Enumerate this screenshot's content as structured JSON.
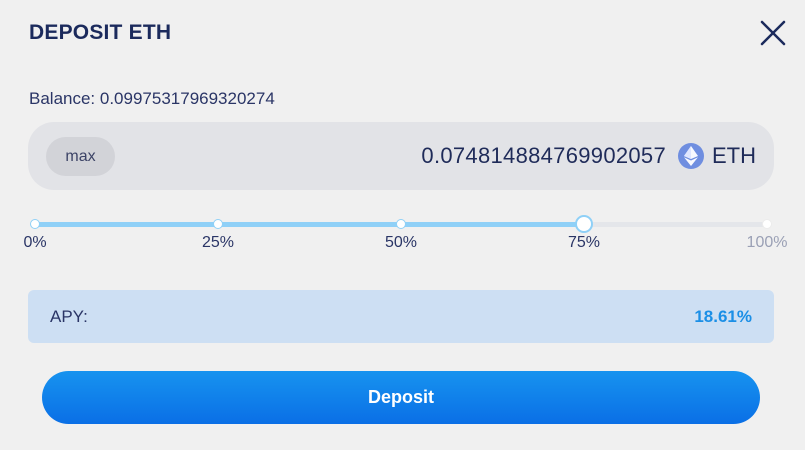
{
  "modal": {
    "title": "DEPOSIT ETH",
    "close_icon": "close-icon"
  },
  "balance": {
    "text": "Balance: 0.09975317969320274"
  },
  "amount": {
    "max_label": "max",
    "value": "0.074814884769902057",
    "token_symbol": "ETH",
    "token_icon": "ethereum-icon",
    "token_icon_color": "#6f8ee0"
  },
  "slider": {
    "value_percent": 75,
    "ticks": [
      {
        "percent": 0,
        "label": "0%"
      },
      {
        "percent": 25,
        "label": "25%"
      },
      {
        "percent": 50,
        "label": "50%"
      },
      {
        "percent": 75,
        "label": "75%"
      },
      {
        "percent": 100,
        "label": "100%"
      }
    ],
    "active_color": "#8fd0f7"
  },
  "apy": {
    "label": "APY:",
    "value": "18.61%",
    "value_color": "#1b8fe6"
  },
  "deposit": {
    "label": "Deposit",
    "color": "#0a7bea"
  }
}
